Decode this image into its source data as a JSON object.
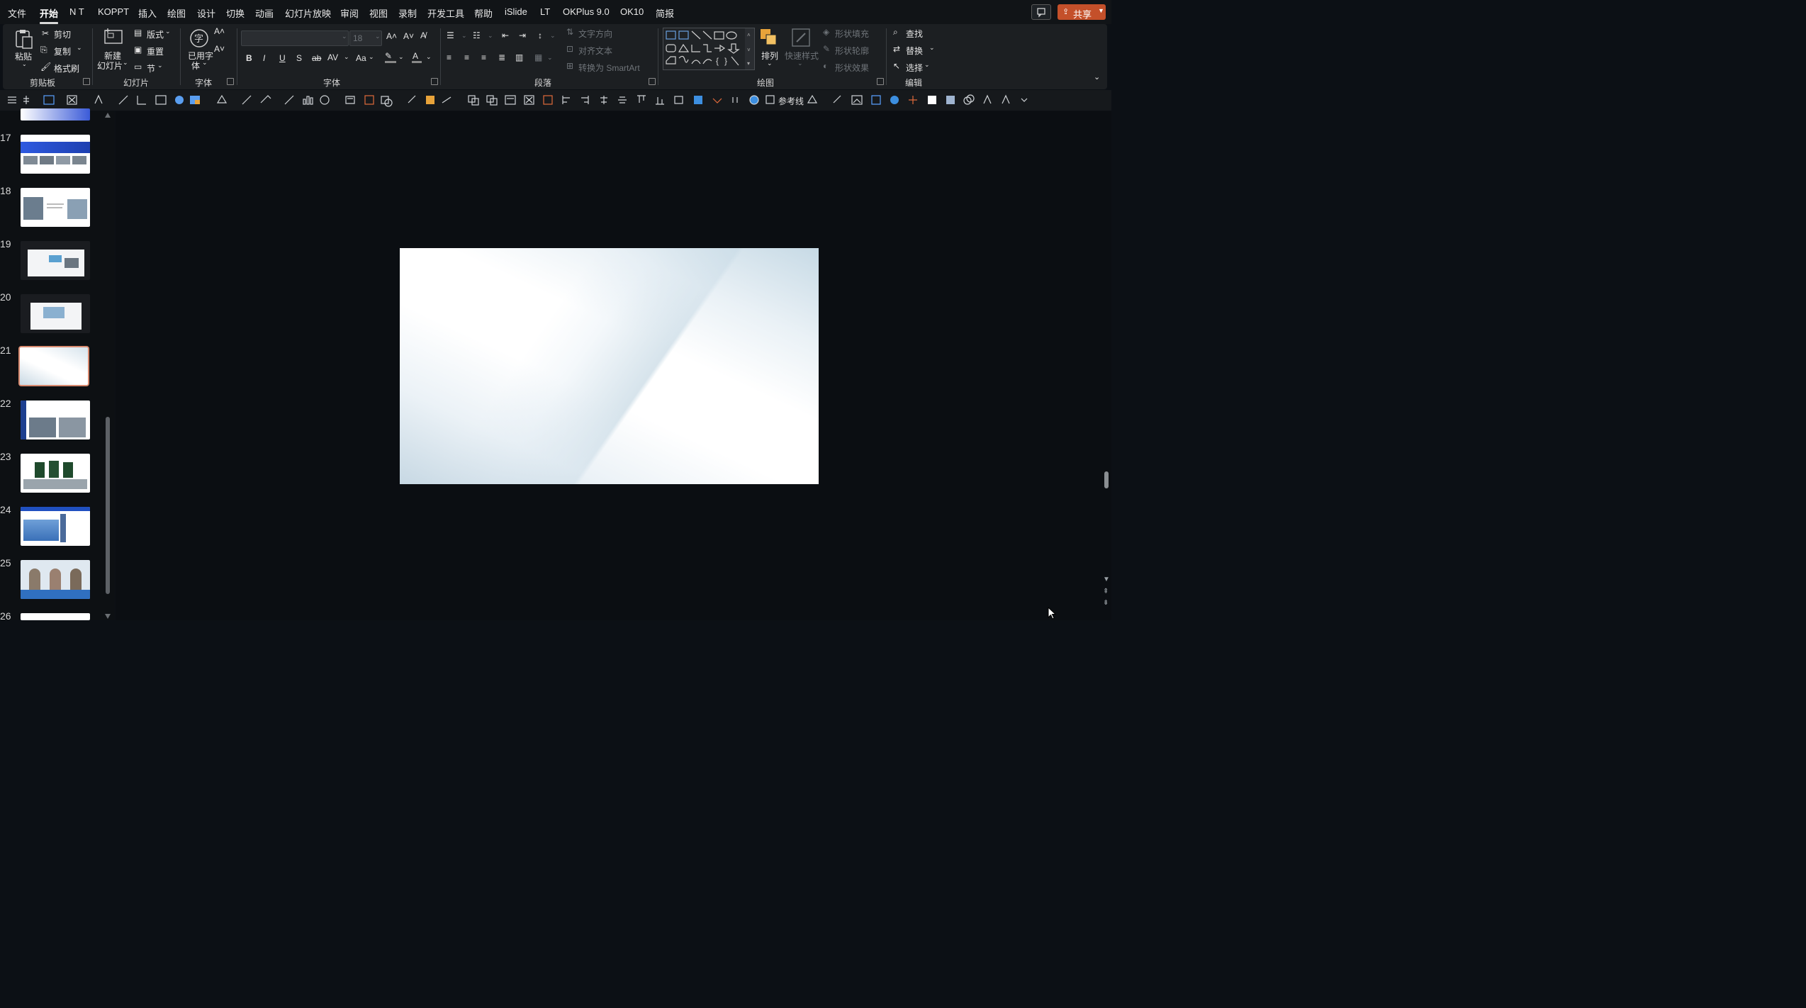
{
  "menu": {
    "items": [
      "文件",
      "开始",
      "N T",
      "KOPPT",
      "插入",
      "绘图",
      "设计",
      "切换",
      "动画",
      "幻灯片放映",
      "审阅",
      "视图",
      "录制",
      "开发工具",
      "帮助",
      "iSlide",
      "LT",
      "OKPlus 9.0",
      "OK10",
      "简报"
    ],
    "active": "开始",
    "share_label": "共享"
  },
  "ribbon": {
    "clipboard": {
      "paste": "粘贴",
      "cut": "剪切",
      "copy": "复制",
      "format_painter": "格式刷",
      "label": "剪贴板"
    },
    "slides": {
      "new_slide_1": "新建",
      "new_slide_2": "幻灯片",
      "layout": "版式",
      "reset": "重置",
      "section": "节",
      "label": "幻灯片"
    },
    "font_used": {
      "line1": "已用字",
      "line2": "体",
      "label": "字体"
    },
    "font": {
      "font_name": "",
      "font_size": "18",
      "label": "字体"
    },
    "paragraph": {
      "text_direction": "文字方向",
      "align_text": "对齐文本",
      "smartart": "转换为 SmartArt",
      "label": "段落"
    },
    "drawing": {
      "arrange": "排列",
      "quick_styles": "快速样式",
      "shape_fill": "形状填充",
      "shape_outline": "形状轮廓",
      "shape_effects": "形状效果",
      "label": "绘图"
    },
    "editing": {
      "find": "查找",
      "replace": "替换",
      "select": "选择",
      "label": "编辑"
    }
  },
  "qat": {
    "guides_label": "参考线"
  },
  "slides_panel": {
    "numbers": [
      "17",
      "18",
      "19",
      "20",
      "21",
      "22",
      "23",
      "24",
      "25",
      "26"
    ],
    "selected": "21"
  },
  "colors": {
    "accent": "#c4502a",
    "selection": "#d88a6f",
    "background": "#0b0e12"
  }
}
